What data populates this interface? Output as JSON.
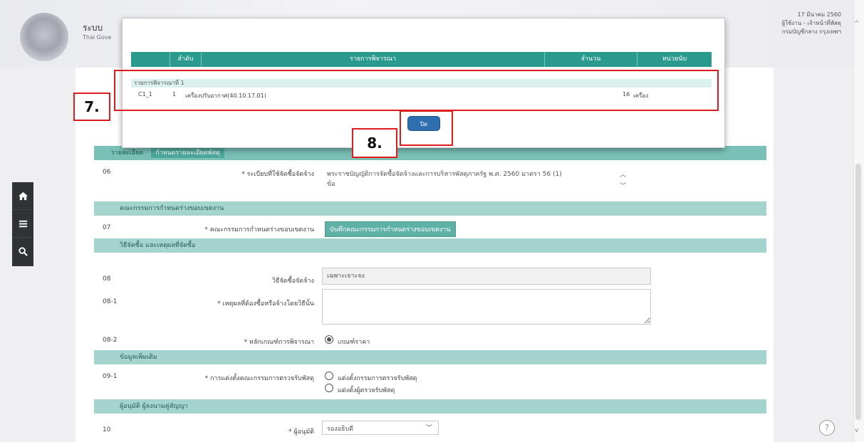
{
  "header": {
    "title": "ระบบ",
    "subtitle": "Thai Gove",
    "date": "17 มีนาคม 2560",
    "user": "ผู้ใช้งาน - เจ้าหน้าที่พัสดุ",
    "org": "กรมบัญชีกลาง กรุงเทพฯ"
  },
  "modal": {
    "columns": [
      "ลำดับ",
      "รายการพิจารณา",
      "จำนวน",
      "หน่วยนับ"
    ],
    "group_label": "รายการพิจารณาที่ 1",
    "row": {
      "code": "C1_1",
      "index": "1",
      "item": "เครื่องปรับอากาศ(40.10.17.01)",
      "qty": "16",
      "unit": "เครื่อง"
    },
    "close_label": "ปิด"
  },
  "callouts": {
    "seven": "7.",
    "eight": "8."
  },
  "form": {
    "tab_left": "รายละเอียด",
    "tab_right": "กำหนดรายละเอียดพัสดุ",
    "row06": {
      "num": "06",
      "label": "* ระเบียบที่ใช้จัดซื้อจัดจ้าง",
      "value": "พระราชบัญญัติการจัดซื้อจัดจ้างและการบริหารพัสดุภาครัฐ พ.ศ. 2560 มาตรา 56 (1)",
      "value2": "ข้อ"
    },
    "sec_committee": "คณะกรรมการกำหนดร่างขอบเขตงาน",
    "row07": {
      "num": "07",
      "label": "* คณะกรรมการกำหนดร่างขอบเขตงาน",
      "button": "บันทึกคณะกรรมการกำหนดร่างขอบเขตงาน"
    },
    "sec_method": "วิธีจัดซื้อ และเหตุผลที่จัดซื้อ",
    "row08": {
      "num": "08",
      "label": "วิธีจัดซื้อจัดจ้าง",
      "value": "เฉพาะเจาะจง"
    },
    "row08_1": {
      "num": "08-1",
      "label": "* เหตุผลที่ต้องซื้อหรือจ้างโดยวิธีนั้น",
      "value": ""
    },
    "row08_2": {
      "num": "08-2",
      "label": "* หลักเกณฑ์การพิจารณา",
      "option": "เกณฑ์ราคา"
    },
    "sec_other": "ข้อมูลเพิ่มเติม",
    "row09_1": {
      "num": "09-1",
      "label": "* การแต่งตั้งคณะกรรมการตรวจรับพัสดุ",
      "opt1": "แต่งตั้งกรรมการตรวจรับพัสดุ",
      "opt2": "แต่งตั้งผู้ตรวจรับพัสดุ"
    },
    "sec_approver": "ผู้อนุมัติ ผู้ลงนามคู่สัญญา",
    "row10": {
      "num": "10",
      "label": "* ผู้อนุมัติ",
      "value": "รองอธิบดี"
    }
  },
  "colors": {
    "modal_header": "#2a9a8e",
    "annotation": "#e01b1b",
    "close_button": "#2f6fb0"
  },
  "toolbar_icons": [
    "home-icon",
    "menu-icon",
    "search-icon"
  ]
}
